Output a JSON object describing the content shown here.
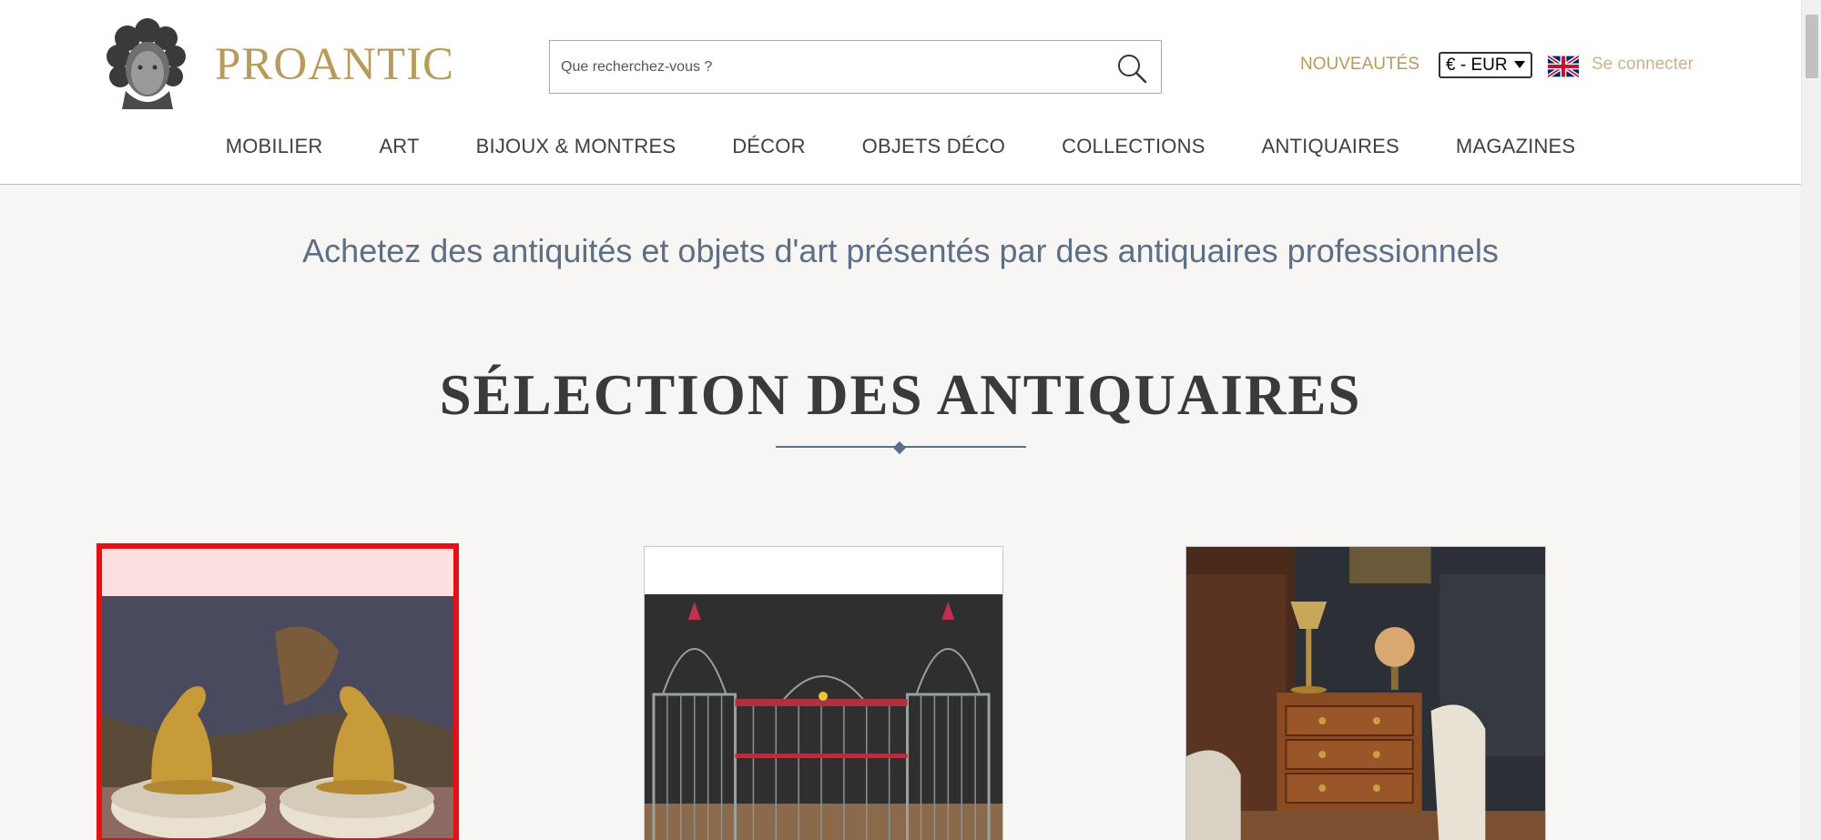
{
  "header": {
    "logo_text": "PROANTIC",
    "search": {
      "placeholder": "Que recherchez-vous ?",
      "value": ""
    },
    "nouveautes_label": "NOUVEAUTÉS",
    "currency_selected": "€ - EUR",
    "language_icon": "uk-flag-icon",
    "login_label": "Se connecter"
  },
  "nav": {
    "items": [
      {
        "label": "MOBILIER"
      },
      {
        "label": "ART"
      },
      {
        "label": "BIJOUX & MONTRES"
      },
      {
        "label": "DÉCOR"
      },
      {
        "label": "OBJETS DÉCO"
      },
      {
        "label": "COLLECTIONS"
      },
      {
        "label": "ANTIQUAIRES"
      },
      {
        "label": "MAGAZINES"
      }
    ]
  },
  "main": {
    "tagline": "Achetez des antiquités et objets d'art présentés par des antiquaires professionnels",
    "section_title": "SÉLECTION DES ANTIQUAIRES"
  },
  "colors": {
    "brand_gold": "#b89a5a",
    "accent_blue": "#5c6f85",
    "selection_red": "#e80f12"
  }
}
